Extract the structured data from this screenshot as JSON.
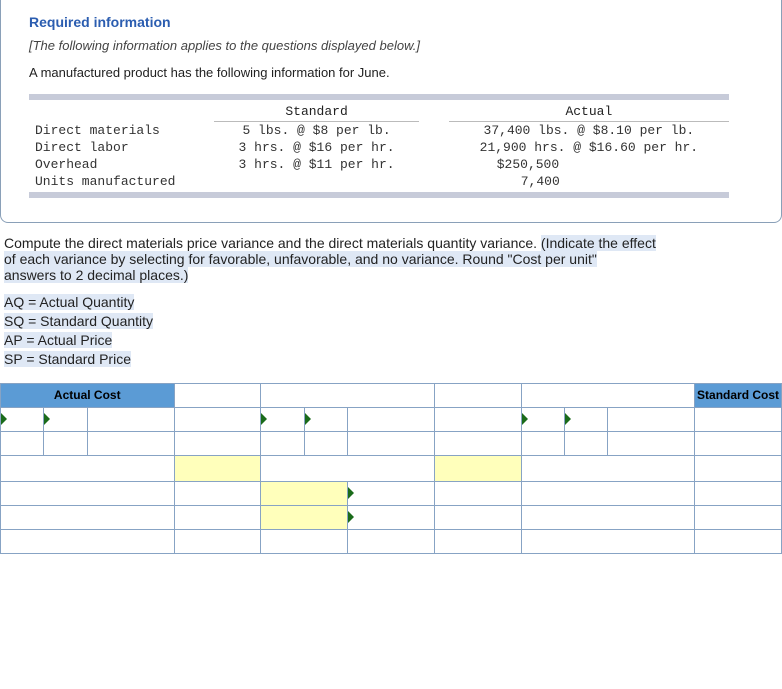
{
  "heading": "Required information",
  "subtitle": "[The following information applies to the questions displayed below.]",
  "intro": "A manufactured product has the following information for June.",
  "table": {
    "col_standard": "Standard",
    "col_actual": "Actual",
    "rows": [
      {
        "label": "Direct materials",
        "standard": "5 lbs. @ $8 per lb.",
        "actual": "37,400 lbs. @ $8.10 per lb."
      },
      {
        "label": "Direct labor",
        "standard": "3 hrs. @ $16 per hr.",
        "actual": "21,900 hrs. @ $16.60 per hr."
      },
      {
        "label": "Overhead",
        "standard": "3 hrs. @ $11 per hr.",
        "actual": "$250,500"
      },
      {
        "label": "Units manufactured",
        "standard": "",
        "actual": "7,400"
      }
    ]
  },
  "question": {
    "p1": "Compute the direct materials price variance and the direct materials quantity variance. ",
    "p2_hl": "(Indicate the effect ",
    "p3_hl": "of each variance by selecting for favorable, unfavorable, and no variance. Round \"Cost per unit\" ",
    "p4_hl": "answers to 2 decimal places.)"
  },
  "legend": {
    "aq": "AQ = Actual Quantity",
    "sq": "SQ = Standard Quantity",
    "ap": "AP = Actual Price",
    "sp": "SP = Standard Price"
  },
  "var_table": {
    "actual_cost": "Actual Cost",
    "standard_cost": "Standard Cost"
  }
}
